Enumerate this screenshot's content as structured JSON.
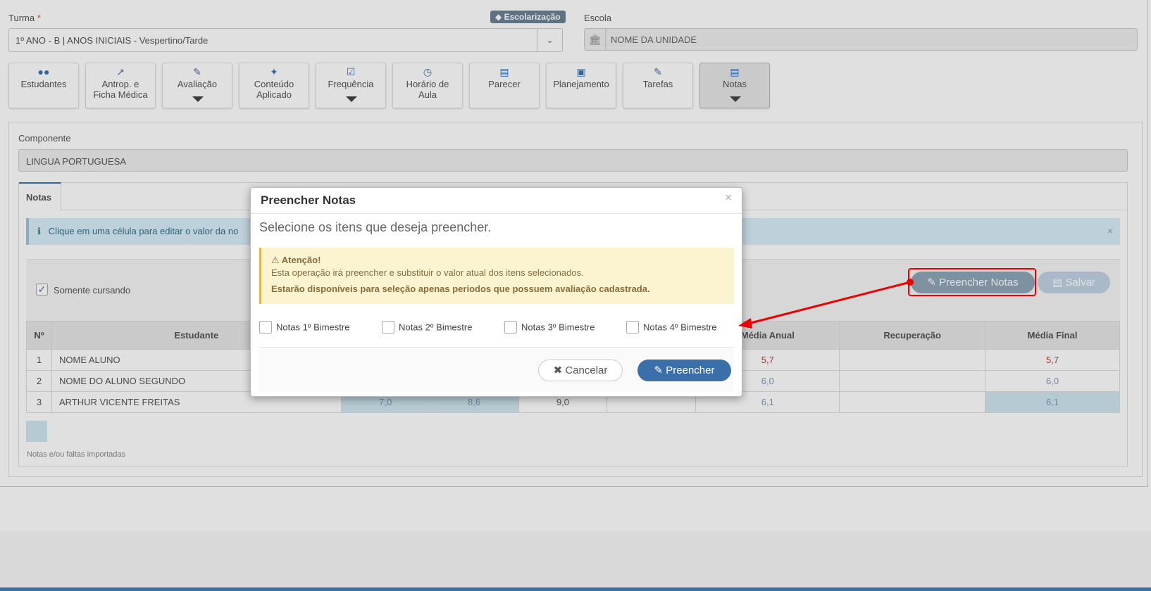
{
  "form": {
    "turma_label": "Turma",
    "required_mark": "*",
    "turma_value": "1º ANO - B | ANOS INICIAIS - Vespertino/Tarde",
    "badge": "Escolarização",
    "escola_label": "Escola",
    "escola_value": "NOME DA UNIDADE"
  },
  "nav": {
    "b1": "Estudantes",
    "b2a": "Antrop. e",
    "b2b": "Ficha Médica",
    "b3": "Avaliação",
    "b4a": "Conteúdo",
    "b4b": "Aplicado",
    "b5": "Frequência",
    "b6a": "Horário de",
    "b6b": "Aula",
    "b7": "Parecer",
    "b8": "Planejamento",
    "b9": "Tarefas",
    "b10": "Notas"
  },
  "componente": {
    "label": "Componente",
    "value": "LINGUA PORTUGUESA"
  },
  "tab": {
    "notas": "Notas"
  },
  "info": {
    "text": "Clique em uma célula para editar o valor da no",
    "close": "×"
  },
  "toolbar": {
    "somente_cursando": "Somente cursando",
    "preencher_notas": "Preencher Notas",
    "salvar": "Salvar"
  },
  "table": {
    "headers": {
      "num": "Nº",
      "estudante": "Estudante",
      "media_anual": "Média Anual",
      "recuperacao": "Recuperação",
      "media_final": "Média Final"
    },
    "rows": [
      {
        "num": "1",
        "name": "NOME ALUNO",
        "c1": "",
        "c2": "",
        "c3": "",
        "c4": "",
        "anual": "5,7",
        "rec": "",
        "final": "5,7"
      },
      {
        "num": "2",
        "name": "NOME DO ALUNO SEGUNDO",
        "c1": "",
        "c2": "",
        "c3": "",
        "c4": "",
        "anual": "6,0",
        "rec": "",
        "final": "6,0"
      },
      {
        "num": "3",
        "name": "ARTHUR VICENTE FREITAS",
        "c1": "7,0",
        "c2": "8,6",
        "c3": "9,0",
        "c4": "",
        "anual": "6,1",
        "rec": "",
        "final": "6,1"
      }
    ]
  },
  "legend": "Notas e/ou faltas importadas",
  "modal": {
    "title": "Preencher Notas",
    "close": "×",
    "subtitle": "Selecione os itens que deseja preencher.",
    "warn_title": "Atenção!",
    "warn_line1": "Esta operação irá preencher e substituir o valor atual dos itens selecionados.",
    "warn_line2": "Estarão disponíveis para seleção apenas periodos que possuem avaliação cadastrada.",
    "opt1": "Notas 1º Bimestre",
    "opt2": "Notas 2º Bimestre",
    "opt3": "Notas 3º Bimestre",
    "opt4": "Notas 4º Bimestre",
    "cancel": "Cancelar",
    "fill": "Preencher"
  },
  "colors": {
    "accent": "#3a6faa",
    "annotation": "#e00000",
    "warning_bg": "#fcf3d1"
  }
}
